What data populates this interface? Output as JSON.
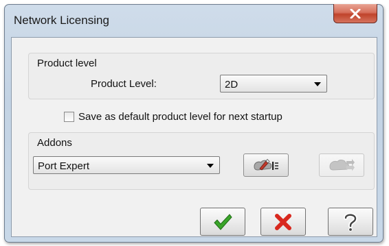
{
  "window": {
    "title": "Network Licensing"
  },
  "product_group": {
    "legend": "Product level",
    "label": "Product Level:",
    "selected_value": "2D"
  },
  "default_checkbox": {
    "label": "Save as default product level for next startup",
    "checked": false
  },
  "addons_group": {
    "legend": "Addons",
    "selected_value": "Port Expert"
  },
  "icons": {
    "close": "close-icon",
    "addon_edit": "edit-addons-icon",
    "addon_other": "addon-action-icon",
    "ok": "checkmark-icon",
    "cancel": "red-x-icon",
    "help": "question-mark-icon"
  },
  "colors": {
    "close_button": "#c74a33",
    "ok_check": "#3aa52a",
    "cancel_x": "#d8281e"
  }
}
